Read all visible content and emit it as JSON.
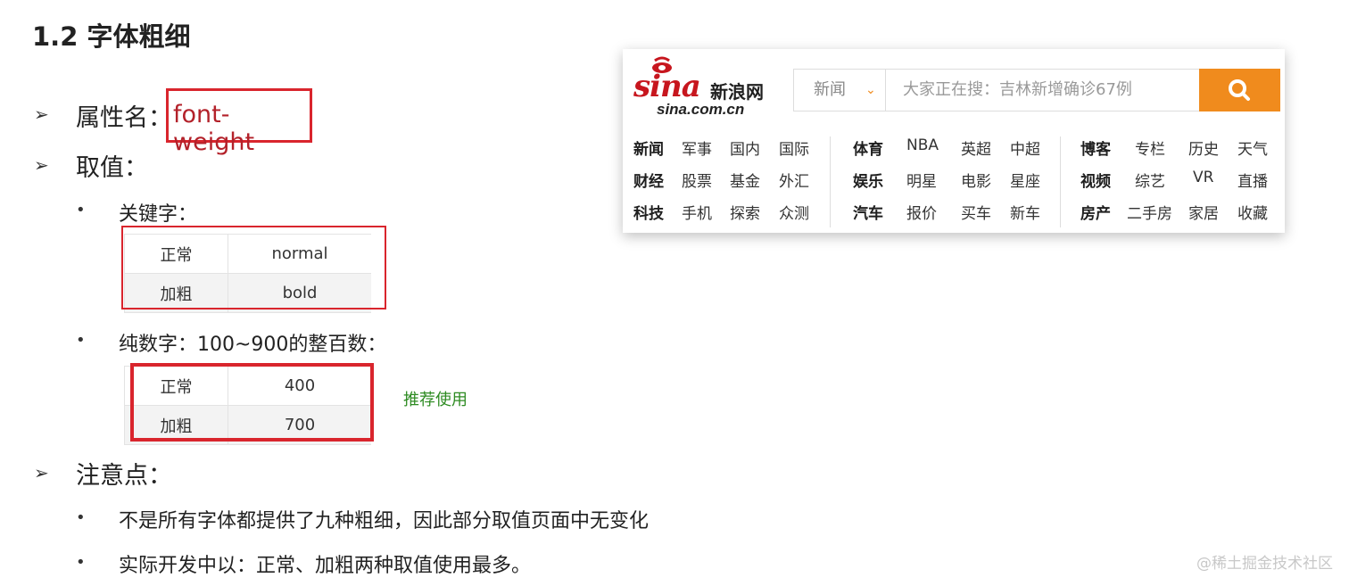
{
  "section_title": "1.2 字体粗细",
  "property": {
    "label": "属性名：",
    "value": "font-weight"
  },
  "values_heading": "取值：",
  "keywords": {
    "label": "关键字：",
    "rows": [
      [
        "正常",
        "normal"
      ],
      [
        "加粗",
        "bold"
      ]
    ]
  },
  "numbers": {
    "label": "纯数字：100~900的整百数：",
    "rows": [
      [
        "正常",
        "400"
      ],
      [
        "加粗",
        "700"
      ]
    ],
    "note": "推荐使用"
  },
  "notes": {
    "heading": "注意点：",
    "items": [
      "不是所有字体都提供了九种粗细，因此部分取值页面中无变化",
      "实际开发中以：正常、加粗两种取值使用最多。"
    ]
  },
  "sina": {
    "logo_word": "sina",
    "logo_cn": "新浪网",
    "logo_domain": "sina.com.cn",
    "search_category": "新闻",
    "search_placeholder": "大家正在搜：吉林新增确诊67例",
    "nav_groups": [
      {
        "rows": [
          [
            "新闻",
            "军事",
            "国内",
            "国际"
          ],
          [
            "财经",
            "股票",
            "基金",
            "外汇"
          ],
          [
            "科技",
            "手机",
            "探索",
            "众测"
          ]
        ]
      },
      {
        "rows": [
          [
            "体育",
            "NBA",
            "英超",
            "中超"
          ],
          [
            "娱乐",
            "明星",
            "电影",
            "星座"
          ],
          [
            "汽车",
            "报价",
            "买车",
            "新车"
          ]
        ]
      },
      {
        "rows": [
          [
            "博客",
            "专栏",
            "历史",
            "天气"
          ],
          [
            "视频",
            "综艺",
            "VR",
            "直播"
          ],
          [
            "房产",
            "二手房",
            "家居",
            "收藏"
          ]
        ]
      }
    ],
    "colors": {
      "brand_red": "#c7161e",
      "search_orange": "#f08b1d"
    }
  },
  "watermark": "@稀土掘金技术社区",
  "colors": {
    "highlight_red": "#d9252d",
    "value_red": "#b3212a",
    "recommend_green": "#2e8b22"
  }
}
